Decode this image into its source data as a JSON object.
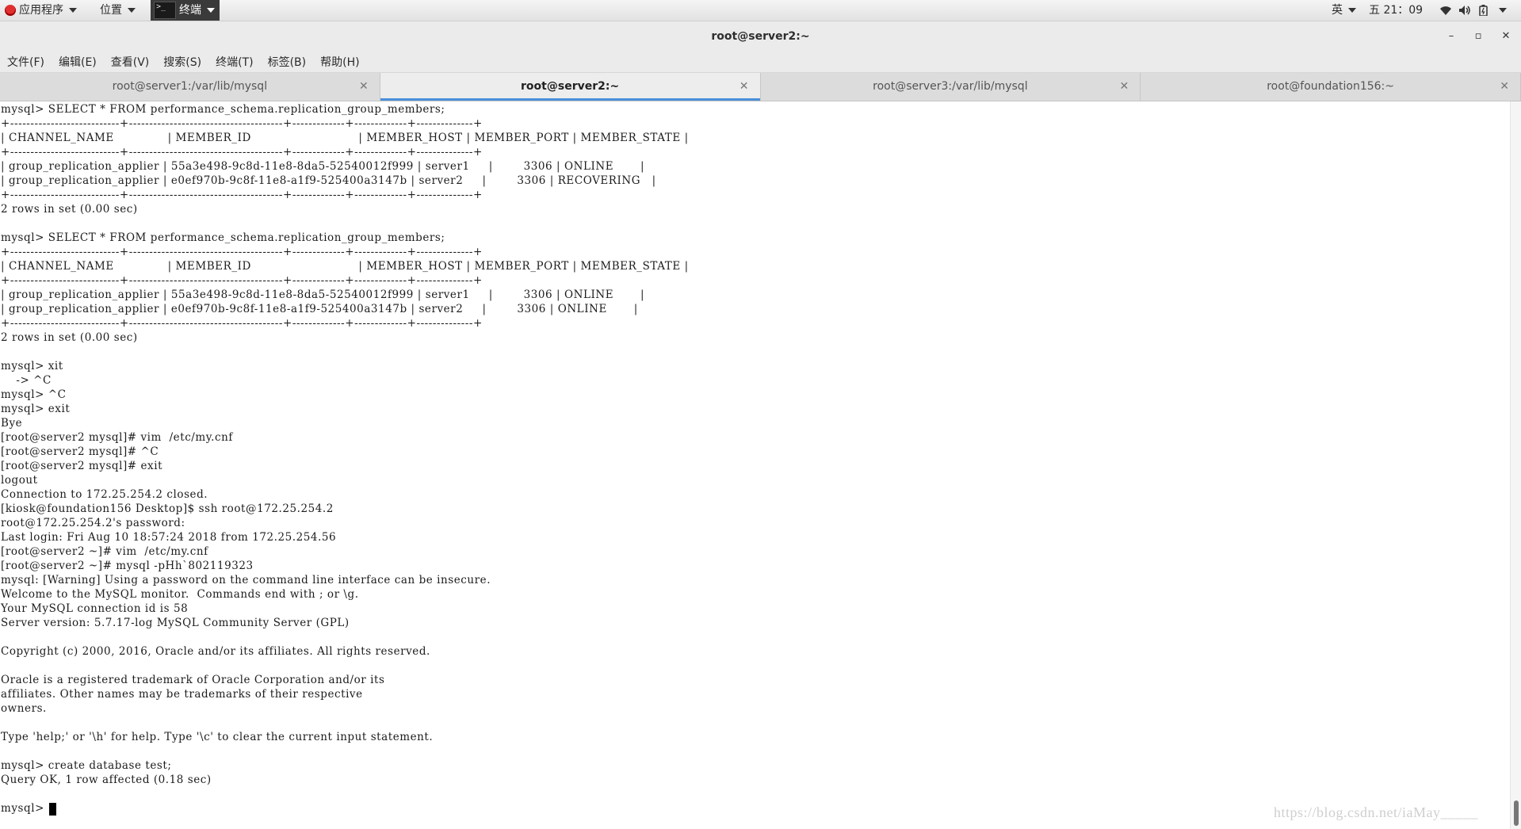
{
  "top_panel": {
    "applications_label": "应用程序",
    "places_label": "位置",
    "task_label": "终端",
    "task_icon_glyph": ">_",
    "input_method": "英",
    "clock": "五 21：09",
    "icons": [
      "redhat-icon",
      "wifi-icon",
      "volume-icon",
      "battery-icon",
      "power-icon"
    ]
  },
  "window": {
    "title": "root@server2:~",
    "minimize_glyph": "–",
    "maximize_glyph": "▫",
    "close_glyph": "✕"
  },
  "menu": {
    "items": [
      "文件(F)",
      "编辑(E)",
      "查看(V)",
      "搜索(S)",
      "终端(T)",
      "标签(B)",
      "帮助(H)"
    ]
  },
  "tabs": [
    {
      "label": "root@server1:/var/lib/mysql",
      "active": false
    },
    {
      "label": "root@server2:~",
      "active": true
    },
    {
      "label": "root@server3:/var/lib/mysql",
      "active": false
    },
    {
      "label": "root@foundation156:~",
      "active": false
    }
  ],
  "tab_close_glyph": "✕",
  "terminal": {
    "lines": [
      "mysql> SELECT * FROM performance_schema.replication_group_members;",
      "+---------------------------+--------------------------------------+-------------+-------------+--------------+",
      "| CHANNEL_NAME              | MEMBER_ID                            | MEMBER_HOST | MEMBER_PORT | MEMBER_STATE |",
      "+---------------------------+--------------------------------------+-------------+-------------+--------------+",
      "| group_replication_applier | 55a3e498-9c8d-11e8-8da5-52540012f999 | server1     |        3306 | ONLINE       |",
      "| group_replication_applier | e0ef970b-9c8f-11e8-a1f9-525400a3147b | server2     |        3306 | RECOVERING   |",
      "+---------------------------+--------------------------------------+-------------+-------------+--------------+",
      "2 rows in set (0.00 sec)",
      "",
      "mysql> SELECT * FROM performance_schema.replication_group_members;",
      "+---------------------------+--------------------------------------+-------------+-------------+--------------+",
      "| CHANNEL_NAME              | MEMBER_ID                            | MEMBER_HOST | MEMBER_PORT | MEMBER_STATE |",
      "+---------------------------+--------------------------------------+-------------+-------------+--------------+",
      "| group_replication_applier | 55a3e498-9c8d-11e8-8da5-52540012f999 | server1     |        3306 | ONLINE       |",
      "| group_replication_applier | e0ef970b-9c8f-11e8-a1f9-525400a3147b | server2     |        3306 | ONLINE       |",
      "+---------------------------+--------------------------------------+-------------+-------------+--------------+",
      "2 rows in set (0.00 sec)",
      "",
      "mysql> xit",
      "    -> ^C",
      "mysql> ^C",
      "mysql> exit",
      "Bye",
      "[root@server2 mysql]# vim  /etc/my.cnf",
      "[root@server2 mysql]# ^C",
      "[root@server2 mysql]# exit",
      "logout",
      "Connection to 172.25.254.2 closed.",
      "[kiosk@foundation156 Desktop]$ ssh root@172.25.254.2",
      "root@172.25.254.2's password:",
      "Last login: Fri Aug 10 18:57:24 2018 from 172.25.254.56",
      "[root@server2 ~]# vim  /etc/my.cnf",
      "[root@server2 ~]# mysql -pHh`802119323",
      "mysql: [Warning] Using a password on the command line interface can be insecure.",
      "Welcome to the MySQL monitor.  Commands end with ; or \\g.",
      "Your MySQL connection id is 58",
      "Server version: 5.7.17-log MySQL Community Server (GPL)",
      "",
      "Copyright (c) 2000, 2016, Oracle and/or its affiliates. All rights reserved.",
      "",
      "Oracle is a registered trademark of Oracle Corporation and/or its",
      "affiliates. Other names may be trademarks of their respective",
      "owners.",
      "",
      "Type 'help;' or '\\h' for help. Type '\\c' to clear the current input statement.",
      "",
      "mysql> create database test;",
      "Query OK, 1 row affected (0.18 sec)",
      ""
    ],
    "prompt": "mysql> "
  },
  "watermark": "https://blog.csdn.net/iaMay_____"
}
